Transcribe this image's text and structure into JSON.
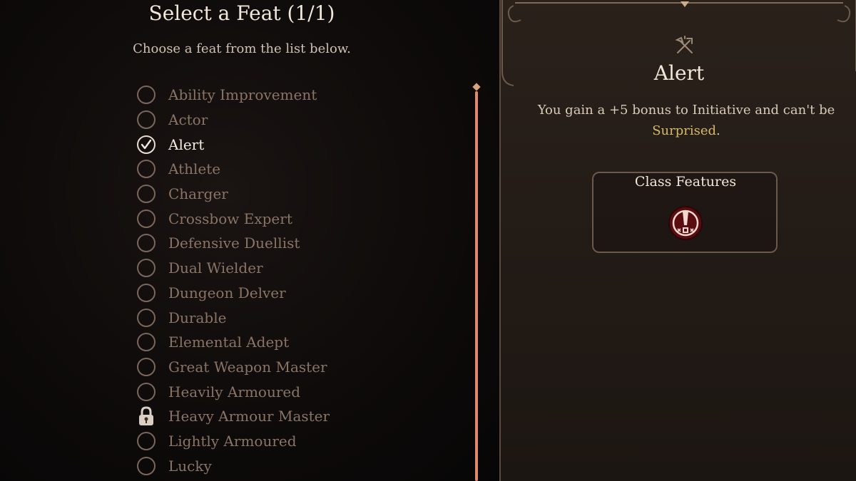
{
  "header": {
    "title": "Select a Feat (1/1)",
    "subtitle": "Choose a feat from the list below."
  },
  "feats": [
    {
      "label": "Ability Improvement",
      "state": "unselected"
    },
    {
      "label": "Actor",
      "state": "unselected"
    },
    {
      "label": "Alert",
      "state": "selected"
    },
    {
      "label": "Athlete",
      "state": "unselected"
    },
    {
      "label": "Charger",
      "state": "unselected"
    },
    {
      "label": "Crossbow Expert",
      "state": "unselected"
    },
    {
      "label": "Defensive Duellist",
      "state": "unselected"
    },
    {
      "label": "Dual Wielder",
      "state": "unselected"
    },
    {
      "label": "Dungeon Delver",
      "state": "unselected"
    },
    {
      "label": "Durable",
      "state": "unselected"
    },
    {
      "label": "Elemental Adept",
      "state": "unselected"
    },
    {
      "label": "Great Weapon Master",
      "state": "unselected"
    },
    {
      "label": "Heavily Armoured",
      "state": "unselected"
    },
    {
      "label": "Heavy Armour Master",
      "state": "locked"
    },
    {
      "label": "Lightly Armoured",
      "state": "unselected"
    },
    {
      "label": "Lucky",
      "state": "unselected"
    }
  ],
  "detail": {
    "icon": "crossed-weapons-icon",
    "name": "Alert",
    "description_prefix": "You gain a +5 bonus to Initiative and can't be ",
    "description_keyword": "Surprised",
    "description_suffix": ".",
    "class_features": {
      "title": "Class Features",
      "icon": "alert-exclamation-icon"
    }
  },
  "colors": {
    "accent": "#e0896f",
    "keyword": "#d6b868",
    "inactive_text": "#8a7466",
    "active_text": "#f3ebe0"
  }
}
